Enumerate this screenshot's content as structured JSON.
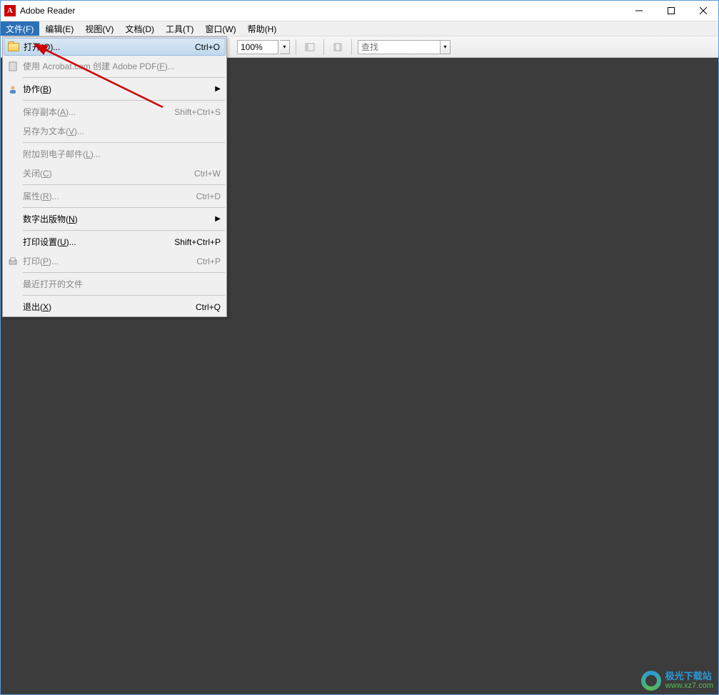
{
  "window": {
    "title": "Adobe Reader"
  },
  "menubar": {
    "file": "文件(F)",
    "edit": "编辑(E)",
    "view": "视图(V)",
    "document": "文档(D)",
    "tools": "工具(T)",
    "window": "窗口(W)",
    "help": "帮助(H)"
  },
  "toolbar": {
    "zoom": "100%",
    "search_placeholder": "查找"
  },
  "file_menu": {
    "open": {
      "label_pre": "打开(",
      "key": "O",
      "label_post": ")...",
      "shortcut": "Ctrl+O"
    },
    "create_pdf": {
      "label_pre": "使用 Acrobat.com 创建 Adobe PDF(",
      "key": "F",
      "label_post": ")..."
    },
    "collab": {
      "label_pre": "协作(",
      "key": "B",
      "label_post": ")"
    },
    "save_copy": {
      "label_pre": "保存副本(",
      "key": "A",
      "label_post": ")...",
      "shortcut": "Shift+Ctrl+S"
    },
    "save_as_text": {
      "label_pre": "另存为文本(",
      "key": "V",
      "label_post": ")..."
    },
    "attach_email": {
      "label_pre": "附加到电子邮件(",
      "key": "L",
      "label_post": ")..."
    },
    "close": {
      "label_pre": "关闭(",
      "key": "C",
      "label_post": ")",
      "shortcut": "Ctrl+W"
    },
    "properties": {
      "label_pre": "属性(",
      "key": "R",
      "label_post": ")...",
      "shortcut": "Ctrl+D"
    },
    "digital_pub": {
      "label_pre": "数字出版物(",
      "key": "N",
      "label_post": ")"
    },
    "print_setup": {
      "label_pre": "打印设置(",
      "key": "U",
      "label_post": ")...",
      "shortcut": "Shift+Ctrl+P"
    },
    "print": {
      "label_pre": "打印(",
      "key": "P",
      "label_post": ")...",
      "shortcut": "Ctrl+P"
    },
    "recent": {
      "label": "最近打开的文件"
    },
    "exit": {
      "label_pre": "退出(",
      "key": "X",
      "label_post": ")",
      "shortcut": "Ctrl+Q"
    }
  },
  "watermark": {
    "cn": "极光下载站",
    "url": "www.xz7.com"
  }
}
